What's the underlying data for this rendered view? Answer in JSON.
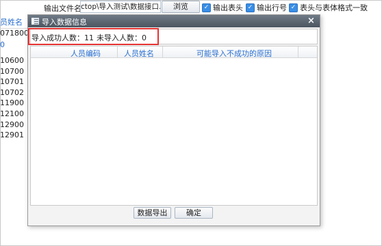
{
  "toolbar": {
    "output_file_label": "输出文件名",
    "output_file_value": "ctop\\导入测试\\数据接口.xls",
    "browse_button": "浏览",
    "checkboxes": [
      {
        "label": "输出表头",
        "checked": true
      },
      {
        "label": "输出行号",
        "checked": true
      },
      {
        "label": "表头与表体格式一致",
        "checked": true
      }
    ]
  },
  "background_grid": {
    "header": "员姓名",
    "first_value": "071800",
    "marker": "0",
    "values": [
      "10600",
      "10700",
      "10701",
      "10702",
      "11900",
      "12100",
      "12900",
      "12901"
    ]
  },
  "dialog": {
    "title": "导入数据信息",
    "close_symbol": "×",
    "summary": {
      "success_text": "导入成功人数：11",
      "failed_text": "未导入人数：0"
    },
    "grid": {
      "columns": [
        "人员编码",
        "人员姓名",
        "可能导入不成功的原因"
      ],
      "rows": []
    },
    "buttons": {
      "export": "数据导出",
      "ok": "确定"
    }
  },
  "colors": {
    "accent": "#2a6fd0",
    "highlight_border": "#e53232",
    "title_bar": "#5a6470"
  }
}
